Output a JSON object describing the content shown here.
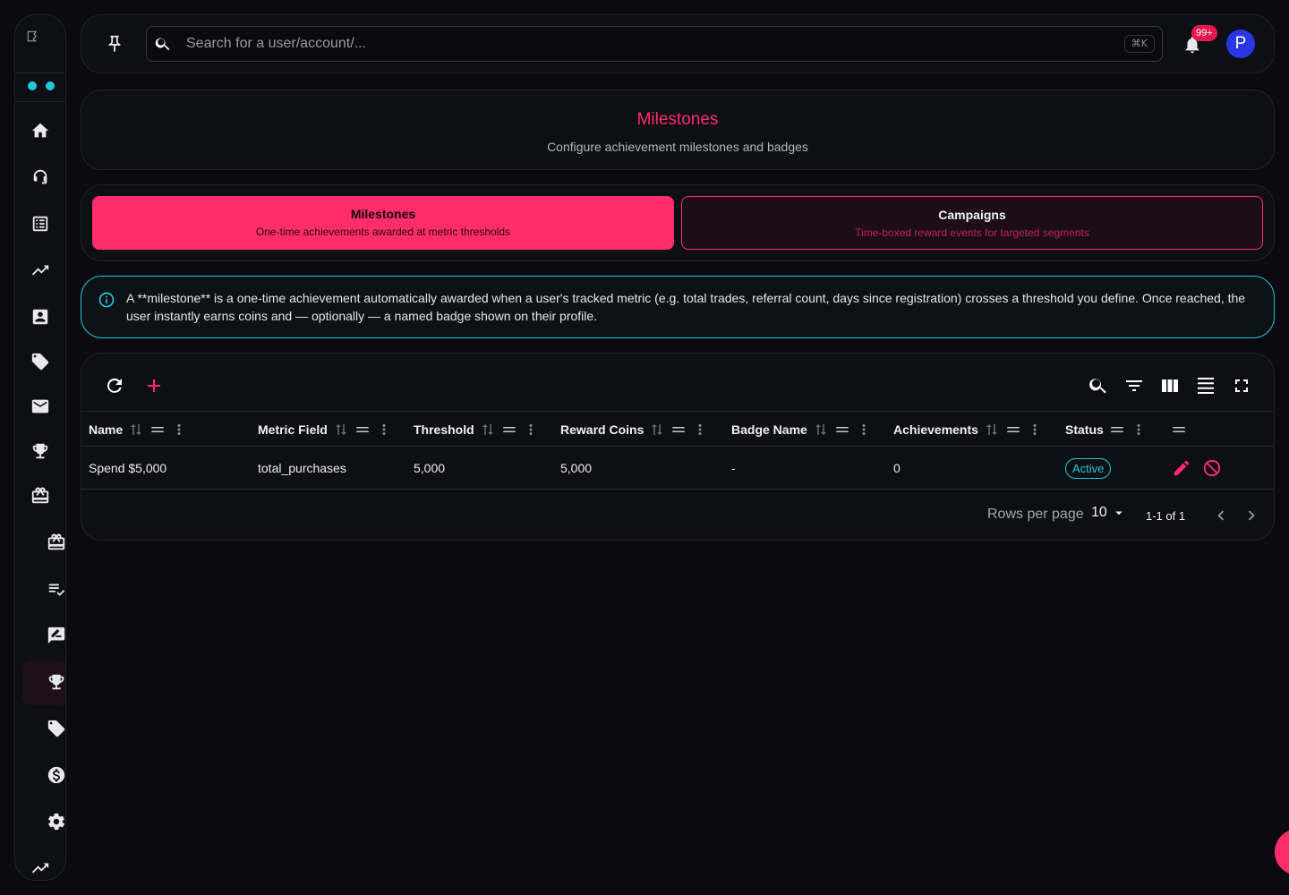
{
  "search": {
    "placeholder": "Search for a user/account/...",
    "shortcut": "⌘K"
  },
  "notifications": {
    "count": "99+"
  },
  "user": {
    "initial": "P"
  },
  "header": {
    "title": "Milestones",
    "subtitle": "Configure achievement milestones and badges"
  },
  "tabs": [
    {
      "label": "Milestones",
      "description": "One-time achievements awarded at metric thresholds",
      "active": true
    },
    {
      "label": "Campaigns",
      "description": "Time-boxed reward events for targeted segments",
      "active": false
    }
  ],
  "info": {
    "text": "A **milestone** is a one-time achievement automatically awarded when a user's tracked metric (e.g. total trades, referral count, days since registration) crosses a threshold you define. Once reached, the user instantly earns coins and — optionally — a named badge shown on their profile."
  },
  "table": {
    "columns": [
      "Name",
      "Metric Field",
      "Threshold",
      "Reward Coins",
      "Badge Name",
      "Achievements",
      "Status"
    ],
    "rows": [
      {
        "name": "Spend $5,000",
        "metric_field": "total_purchases",
        "threshold": "5,000",
        "reward_coins": "5,000",
        "badge_name": "-",
        "achievements": "0",
        "status": "Active"
      }
    ],
    "footer": {
      "rows_per_page_label": "Rows per page",
      "rows_per_page": "10",
      "range": "1-1 of 1"
    }
  },
  "colors": {
    "accent": "#ff2d6a",
    "info": "#22c7d6",
    "avatar": "#2a36e6",
    "background": "#0a0a10"
  }
}
